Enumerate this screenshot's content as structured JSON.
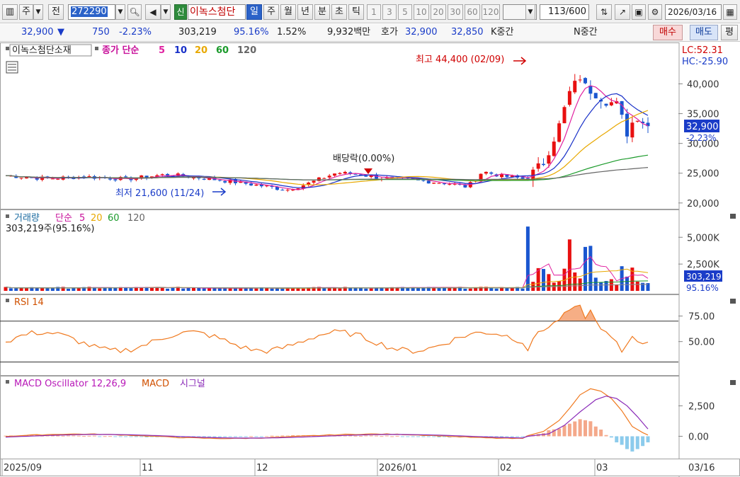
{
  "toolbar": {
    "type_label": "주",
    "jeon_label": "전",
    "code": "272290",
    "sin_badge": "신",
    "stock_name": "이녹스첨단",
    "periods": [
      "일",
      "주",
      "월",
      "년",
      "분",
      "초",
      "틱"
    ],
    "active_period": "일",
    "interval_buttons": [
      "1",
      "3",
      "5",
      "10",
      "20",
      "30",
      "60",
      "120"
    ],
    "count_value": "113",
    "count_max": "/600",
    "date": "2026/03/16",
    "right_icons": [
      "chart-type-icon",
      "line-tool-icon",
      "save-icon",
      "settings-icon",
      "calendar-icon"
    ]
  },
  "info": {
    "price": "32,900",
    "change_arrow": "▼",
    "change": "750",
    "change_pct": "-2.23%",
    "volume": "303,219",
    "vol_ratio": "95.16%",
    "turnover": "1.52%",
    "amount": "9,932백만",
    "hoga_label": "호가",
    "ask": "32,900",
    "bid": "32,850",
    "k_label": "K중간",
    "n_label": "N중간",
    "buy_label": "매수",
    "sell_label": "매도",
    "eval_label": "평"
  },
  "price_panel": {
    "stock_tag": "이녹스첨단소재",
    "ma_title": "종가 단순",
    "ma_periods": [
      "5",
      "10",
      "20",
      "60",
      "120"
    ],
    "ma_colors": [
      "#e020a0",
      "#1830c8",
      "#e8a800",
      "#1a9a2a",
      "#666666"
    ],
    "lc_label": "LC:52.31",
    "hc_label": "HC:-25.90",
    "high_note": "최고 44,400 (02/09)",
    "low_note": "최저 21,600 (11/24)",
    "dividend_note": "배당락(0.00%)",
    "current_price": "32,900",
    "current_pct": "-2.23%"
  },
  "volume_panel": {
    "title": "거래량",
    "ma_title": "단순",
    "ma_periods": [
      "5",
      "20",
      "60",
      "120"
    ],
    "summary": "303,219주(95.16%)",
    "current_volume": "303,219",
    "current_pct": "95.16%"
  },
  "rsi_panel": {
    "title": "RSI 14"
  },
  "macd_panel": {
    "title": "MACD Oscillator 12,26,9",
    "macd_label": "MACD",
    "signal_label": "시그널"
  },
  "x_axis_labels": [
    "2025/09",
    "11",
    "12",
    "2026/01",
    "02",
    "03",
    "03/16"
  ],
  "colors": {
    "up": "#e81010",
    "down": "#1a56d0",
    "rsi": "#f07a20",
    "macd": "#f07a20",
    "signal": "#8a2ab8",
    "osc_up": "#f4a88a",
    "osc_down": "#8ccbec",
    "highlight": "#1a3cc8"
  },
  "chart_data": [
    {
      "type": "candlestick",
      "title": "이녹스첨단소재",
      "y_ticks": [
        20000,
        25000,
        30000,
        35000,
        40000
      ],
      "y_tick_labels": [
        "20,000",
        "25,000",
        "30,000",
        "35,000",
        "40,000"
      ],
      "ylim": [
        19500,
        46000
      ],
      "x_labels": [
        "2025/09",
        "11",
        "12",
        "2026/01",
        "02",
        "03"
      ],
      "high": 44400,
      "low": 21600,
      "last_close": 32900
    },
    {
      "type": "bar",
      "title": "거래량",
      "y_tick_labels": [
        "2,500K",
        "5,000K"
      ],
      "ylim": [
        0,
        6800
      ]
    },
    {
      "type": "line",
      "title": "RSI 14",
      "y_tick_labels": [
        "50.00",
        "75.00"
      ],
      "ylim": [
        20,
        92
      ]
    },
    {
      "type": "line",
      "title": "MACD Oscillator 12,26,9",
      "y_tick_labels": [
        "0.00",
        "2,500"
      ],
      "ylim": [
        -1600,
        4500
      ]
    }
  ]
}
